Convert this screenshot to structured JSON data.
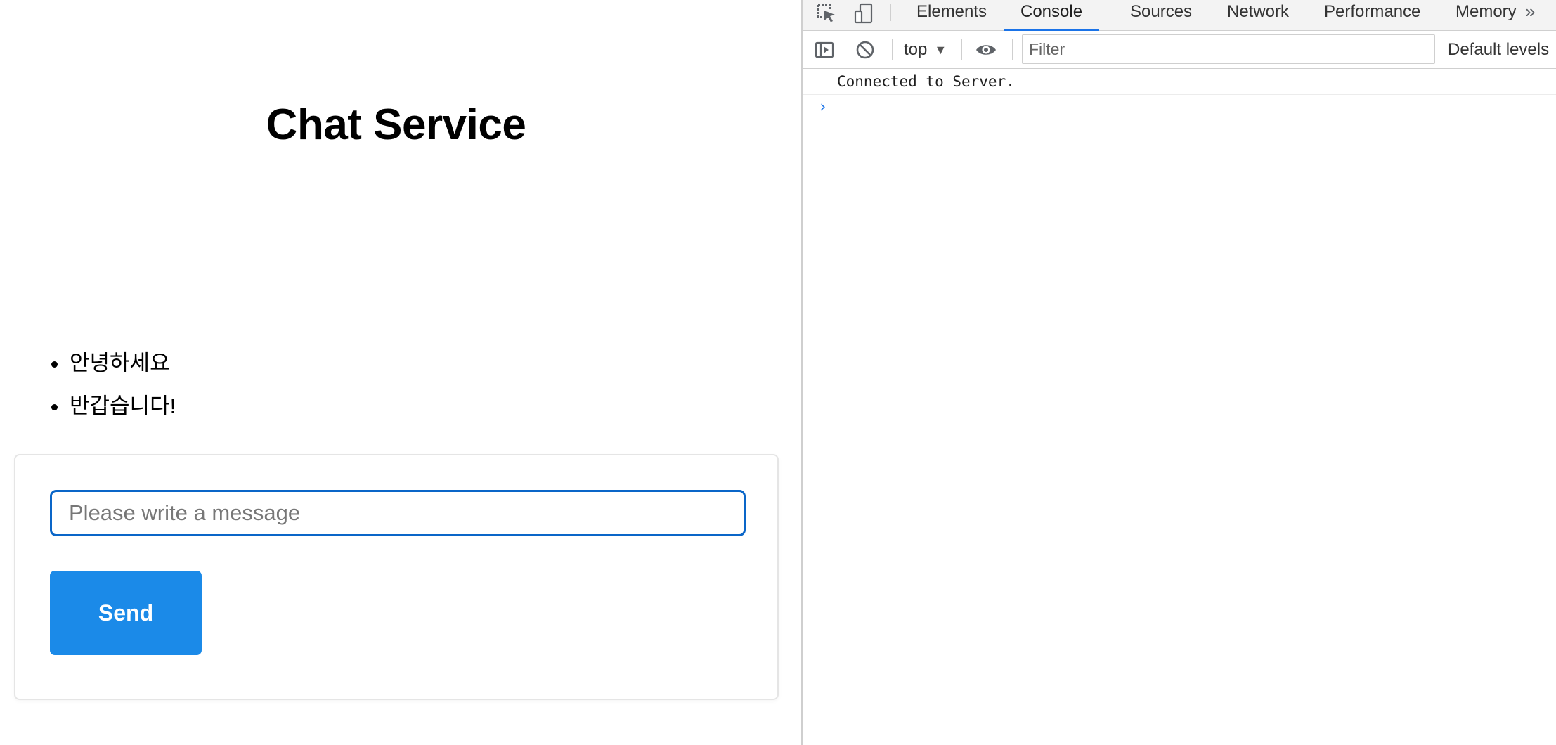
{
  "page": {
    "title": "Chat Service",
    "messages": [
      "안녕하세요",
      "반갑습니다!"
    ],
    "compose": {
      "input_value": "",
      "input_placeholder": "Please write a message",
      "send_label": "Send"
    },
    "colors": {
      "send_button": "#1b8ae8",
      "input_focus_border": "#0a66c8"
    }
  },
  "devtools": {
    "tabs": [
      {
        "label": "Elements"
      },
      {
        "label": "Console"
      },
      {
        "label": "Sources"
      },
      {
        "label": "Network"
      },
      {
        "label": "Performance"
      },
      {
        "label": "Memory"
      }
    ],
    "active_tab": "Console",
    "more_tabs_glyph": "»",
    "toolbar": {
      "context": "top",
      "context_arrow": "▼",
      "filter_placeholder": "Filter",
      "filter_value": "",
      "levels_label": "Default levels"
    },
    "console": {
      "lines": [
        "Connected to Server."
      ],
      "prompt_glyph": "›"
    },
    "icons": [
      "inspect-element-icon",
      "device-toolbar-icon",
      "sidebar-toggle-icon",
      "clear-console-icon",
      "live-expression-eye-icon"
    ],
    "colors": {
      "accent": "#1a73e8"
    }
  }
}
